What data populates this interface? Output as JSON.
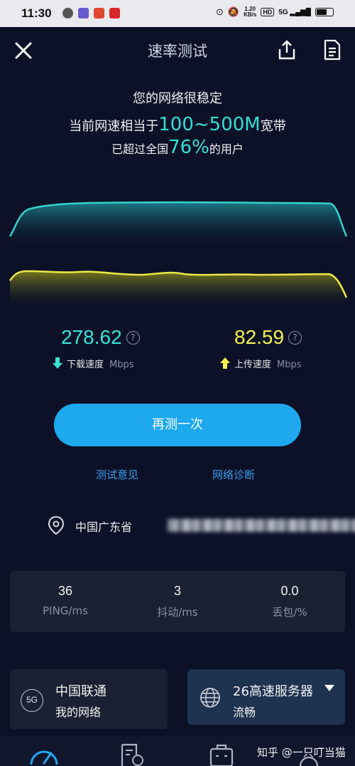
{
  "status_bar": {
    "time": "11:30",
    "net_speed_value": "1.20",
    "net_speed_unit": "KB/s",
    "hd": "HD",
    "signal": "5G"
  },
  "header": {
    "title": "速率测试"
  },
  "summary": {
    "line1": "您的网络很稳定",
    "line2_prefix": "当前网速相当于",
    "line2_highlight": "100~500M",
    "line2_suffix": "宽带",
    "line3_prefix": "已超过全国",
    "line3_highlight": "76%",
    "line3_suffix": "的用户"
  },
  "download": {
    "value": "278.62",
    "label": "下载速度",
    "unit": "Mbps",
    "help": "?"
  },
  "upload": {
    "value": "82.59",
    "label": "上传速度",
    "unit": "Mbps",
    "help": "?"
  },
  "retest_label": "再测一次",
  "links": {
    "feedback": "测试意见",
    "diagnose": "网络诊断"
  },
  "location": {
    "text": "中国广东省"
  },
  "stats": [
    {
      "value": "36",
      "label": "PING/ms"
    },
    {
      "value": "3",
      "label": "抖动/ms"
    },
    {
      "value": "0.0",
      "label": "丢包/%"
    }
  ],
  "network_card": {
    "badge": "5G",
    "carrier": "中国联通",
    "subtitle": "我的网络"
  },
  "server_card": {
    "name": "26高速服务器",
    "status": "流畅"
  },
  "watermark": "知乎 @一只叮当猫",
  "colors": {
    "background": "#0c1128",
    "download_accent": "#37e4d6",
    "upload_accent": "#f5f24e",
    "button": "#1ea8ee",
    "link": "#3a9eea"
  }
}
